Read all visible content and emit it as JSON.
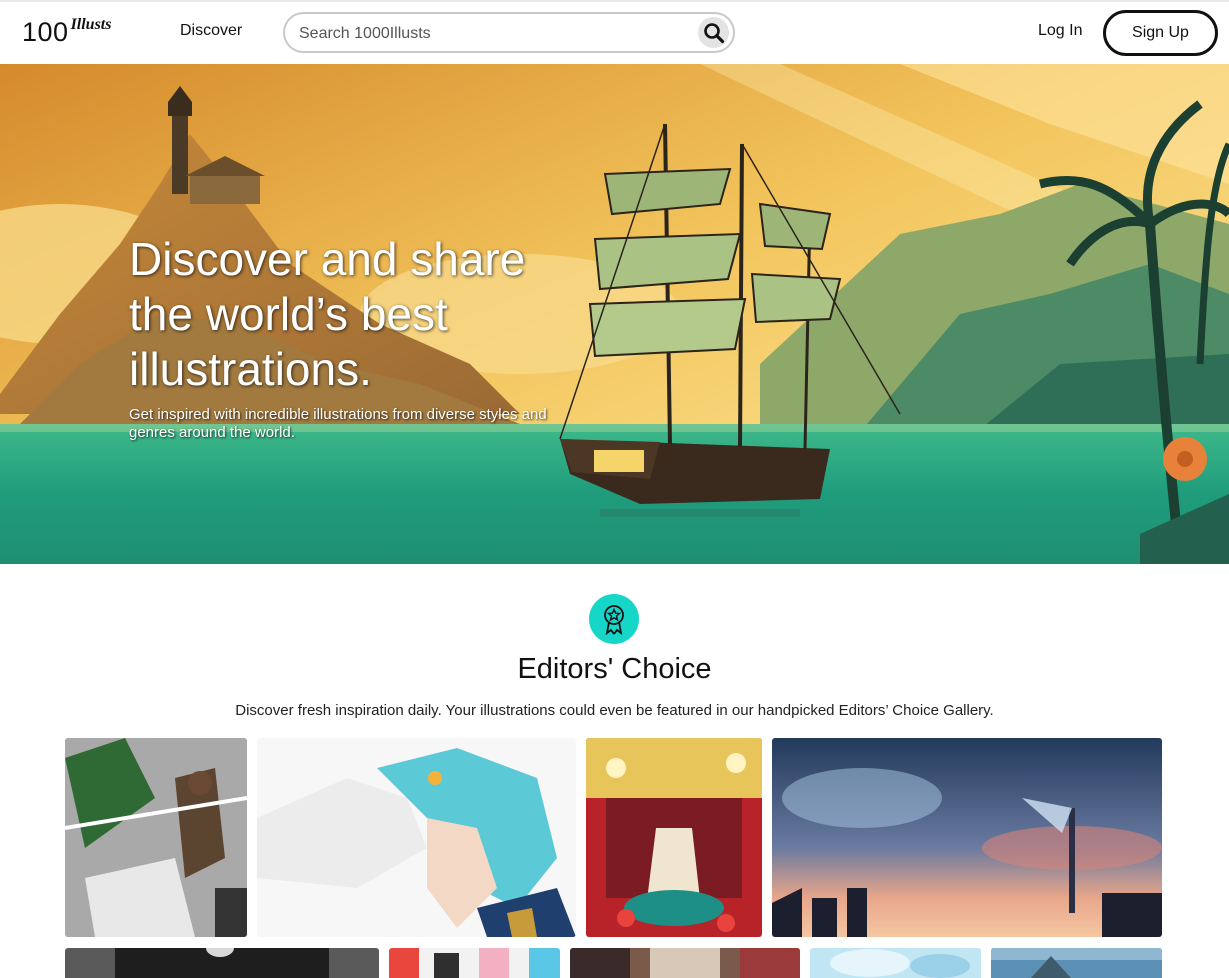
{
  "header": {
    "logo_number": "100",
    "logo_word": "Illusts",
    "nav_discover": "Discover",
    "search_placeholder": "Search 1000Illusts",
    "login_label": "Log In",
    "signup_label": "Sign Up"
  },
  "hero": {
    "title": "Discover and share the world’s best illustrations.",
    "subtitle": "Get inspired with incredible illustrations from diverse styles and genres around the world."
  },
  "editors_choice": {
    "icon": "award-ribbon-icon",
    "title": "Editors' Choice",
    "description": "Discover fresh inspiration daily. Your illustrations could even be featured in our handpicked Editors’ Choice Gallery."
  },
  "colors": {
    "accent_teal": "#16d6c8",
    "text": "#111111"
  },
  "gallery": [
    {
      "name": "soldier-flag-artwork"
    },
    {
      "name": "blue-hair-portrait-artwork"
    },
    {
      "name": "festival-girl-artwork"
    },
    {
      "name": "sunset-sky-girl-artwork"
    },
    {
      "name": "dark-portrait-artwork"
    },
    {
      "name": "colorful-characters-artwork"
    },
    {
      "name": "street-scene-artwork"
    },
    {
      "name": "pastel-fantasy-artwork"
    },
    {
      "name": "sky-landscape-artwork"
    }
  ]
}
